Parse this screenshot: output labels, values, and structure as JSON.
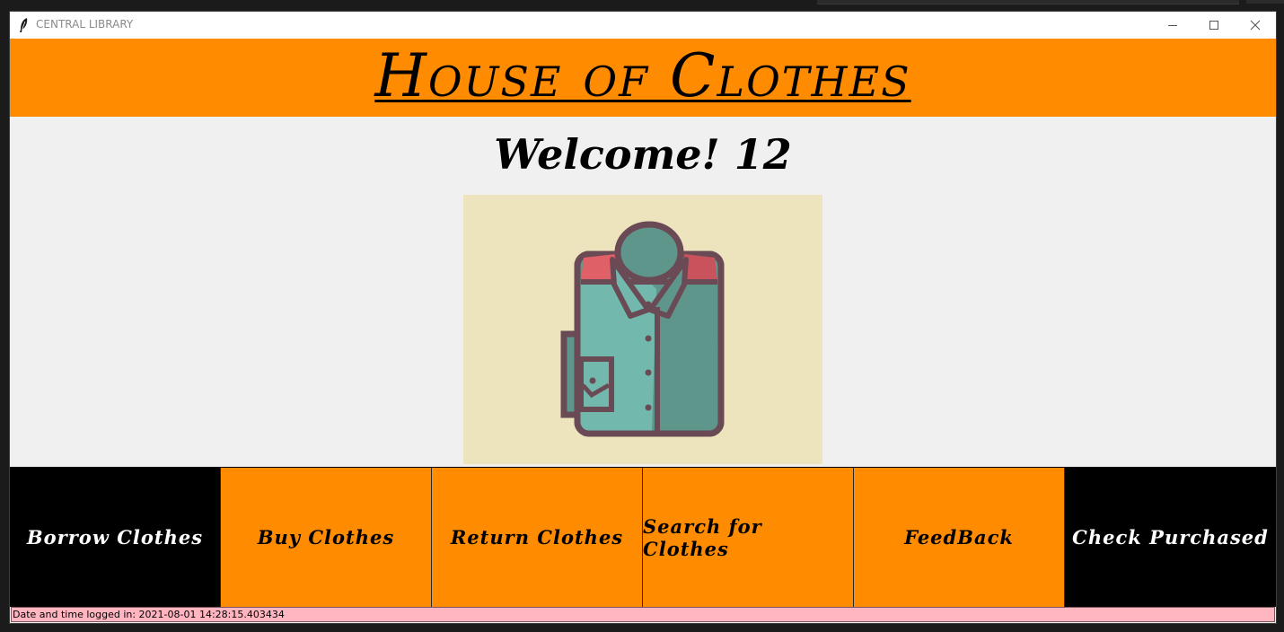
{
  "window": {
    "title": "CENTRAL LIBRARY",
    "minimize_icon": "minimize-icon",
    "maximize_icon": "maximize-icon",
    "close_icon": "close-icon",
    "app_icon": "feather-icon"
  },
  "header": {
    "title": "House of Clothes",
    "background": "#ff8c00"
  },
  "welcome": {
    "text": "Welcome! 12"
  },
  "hero": {
    "icon": "shirt-icon",
    "background": "#ede4bd"
  },
  "nav": {
    "buttons": [
      {
        "label": "Borrow Clothes",
        "bg": "#000000",
        "fg": "#ffffff"
      },
      {
        "label": "Buy Clothes",
        "bg": "#ff8c00",
        "fg": "#000000"
      },
      {
        "label": "Return Clothes",
        "bg": "#ff8c00",
        "fg": "#000000"
      },
      {
        "label": "Search for Clothes",
        "bg": "#ff8c00",
        "fg": "#000000"
      },
      {
        "label": "FeedBack",
        "bg": "#ff8c00",
        "fg": "#000000"
      },
      {
        "label": "Check Purchased",
        "bg": "#000000",
        "fg": "#ffffff"
      }
    ]
  },
  "status_bar": {
    "text": "Date and time logged in: 2021-08-01 14:28:15.403434",
    "background": "#ffb6c1"
  }
}
